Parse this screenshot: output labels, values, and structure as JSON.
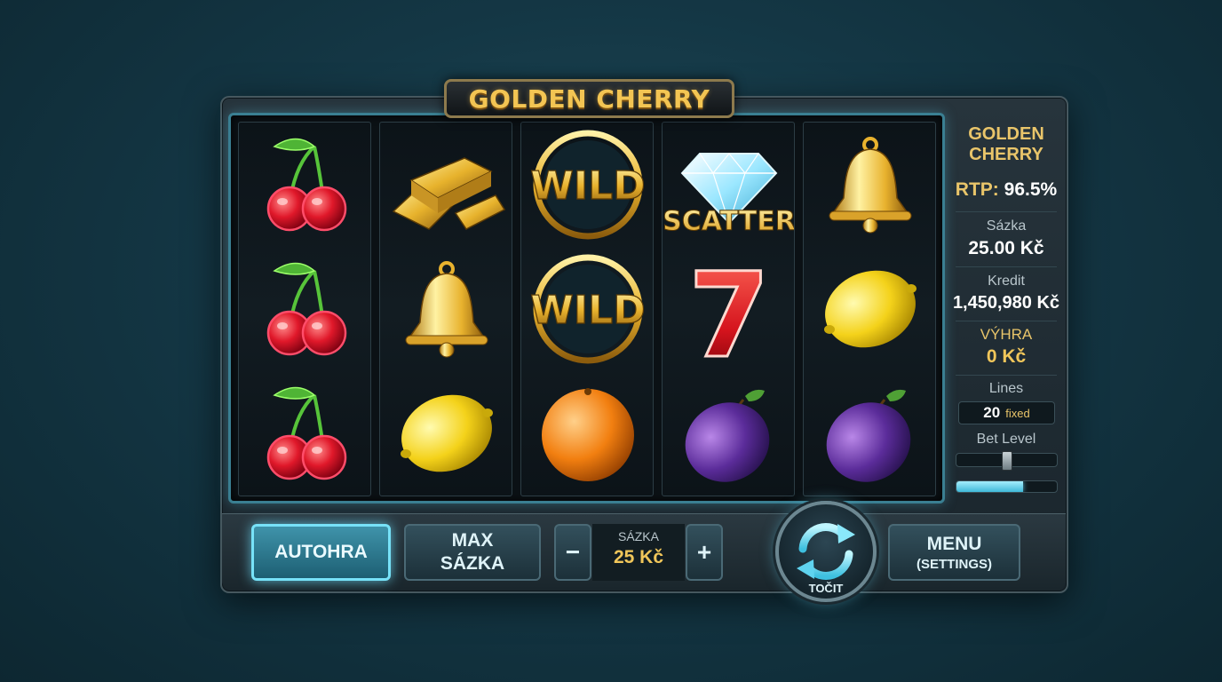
{
  "game": {
    "title": "GOLDEN CHERRY"
  },
  "reels": [
    [
      "cherry",
      "cherry",
      "cherry"
    ],
    [
      "gold-bars",
      "bell",
      "lemon"
    ],
    [
      "wild",
      "wild",
      "orange"
    ],
    [
      "diamond-scatter",
      "seven",
      "plum"
    ],
    [
      "bell",
      "lemon",
      "plum"
    ]
  ],
  "symbols": {
    "wild_text": "WILD",
    "scatter_text": "SCATTER",
    "seven_text": "7"
  },
  "panel": {
    "name_line1": "GOLDEN",
    "name_line2": "CHERRY",
    "rtp_label": "RTP:",
    "rtp_value": "96.5%",
    "bet_label": "Sázka",
    "bet_value": "25.00 Kč",
    "credit_label": "Kredit",
    "credit_value": "1,450,980 Kč",
    "win_label": "VÝHRA",
    "win_value": "0 Kč",
    "lines_label": "Lines",
    "lines_value": "20",
    "lines_note": "fixed",
    "bet_level_label": "Bet Level",
    "bet_level_fraction": 0.5,
    "progress_fraction": 0.66
  },
  "controls": {
    "autoplay_label": "AUTOHRA",
    "max_bet_line1": "MAX",
    "max_bet_line2": "SÁZKA",
    "minus_label": "−",
    "plus_label": "+",
    "bet_display_label": "SÁZKA",
    "bet_display_value": "25 Kč",
    "spin_label": "TOČIT",
    "menu_line1": "MENU",
    "menu_line2": "(SETTINGS)"
  },
  "colors": {
    "accent_cyan": "#77e2f8",
    "gold": "#f0c65a"
  }
}
